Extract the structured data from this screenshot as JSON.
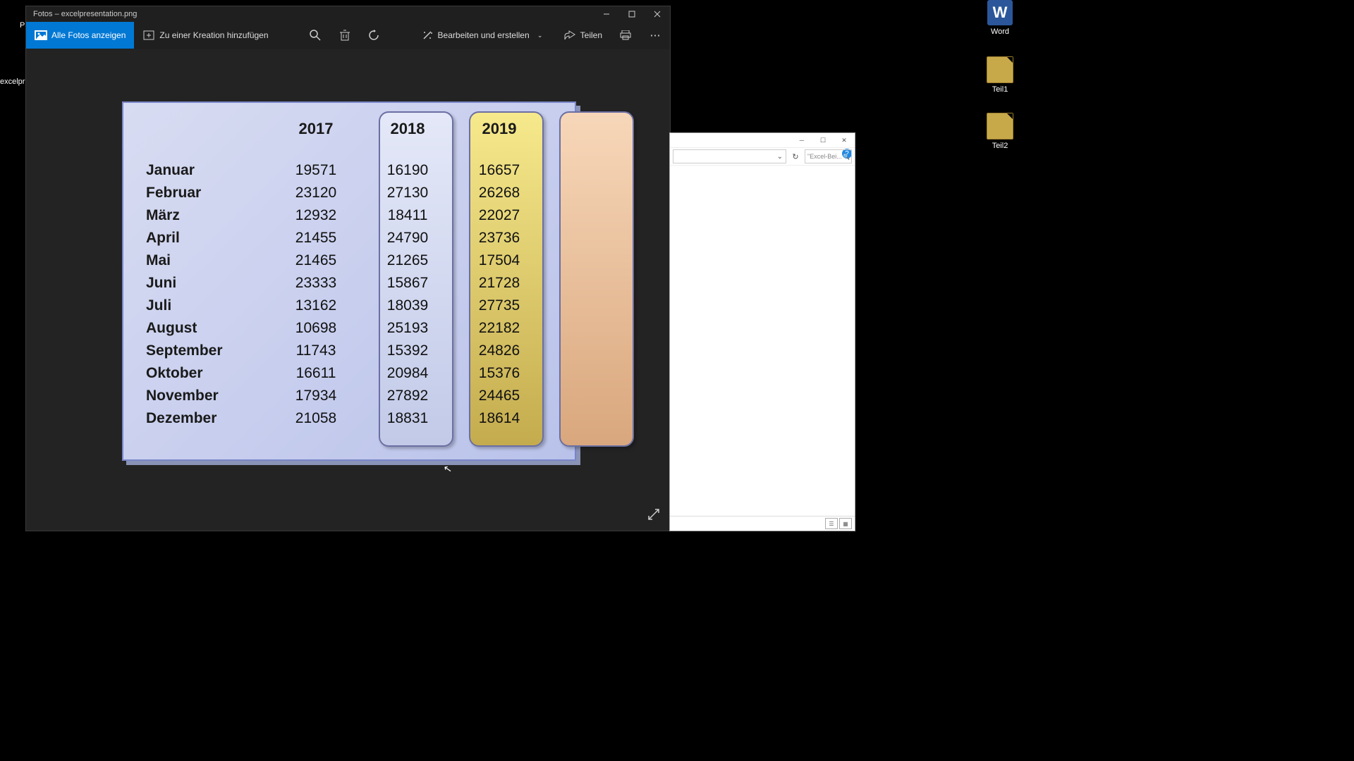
{
  "desktop": {
    "word_label": "Word",
    "teil1_label": "Teil1",
    "teil2_label": "Teil2",
    "papierkorb_fragment": "Pa",
    "excelpres_fragment": "excelpres"
  },
  "photos": {
    "window_title": "Fotos – excelpresentation.png",
    "all_photos_label": "Alle Fotos anzeigen",
    "add_creation_label": "Zu einer Kreation hinzufügen",
    "edit_create_label": "Bearbeiten und erstellen",
    "share_label": "Teilen"
  },
  "explorer": {
    "search_placeholder": "\"Excel-Bei..."
  },
  "chart_data": {
    "type": "table",
    "title": "",
    "columns": [
      "2017",
      "2018",
      "2019"
    ],
    "rows": [
      "Januar",
      "Februar",
      "März",
      "April",
      "Mai",
      "Juni",
      "Juli",
      "August",
      "September",
      "Oktober",
      "November",
      "Dezember"
    ],
    "series": [
      {
        "name": "2017",
        "values": [
          19571,
          23120,
          12932,
          21455,
          21465,
          23333,
          13162,
          10698,
          11743,
          16611,
          17934,
          21058
        ]
      },
      {
        "name": "2018",
        "values": [
          16190,
          27130,
          18411,
          24790,
          21265,
          15867,
          18039,
          25193,
          15392,
          20984,
          27892,
          18831
        ]
      },
      {
        "name": "2019",
        "values": [
          16657,
          26268,
          22027,
          23736,
          17504,
          21728,
          27735,
          22182,
          24826,
          15376,
          24465,
          18614
        ]
      }
    ]
  }
}
